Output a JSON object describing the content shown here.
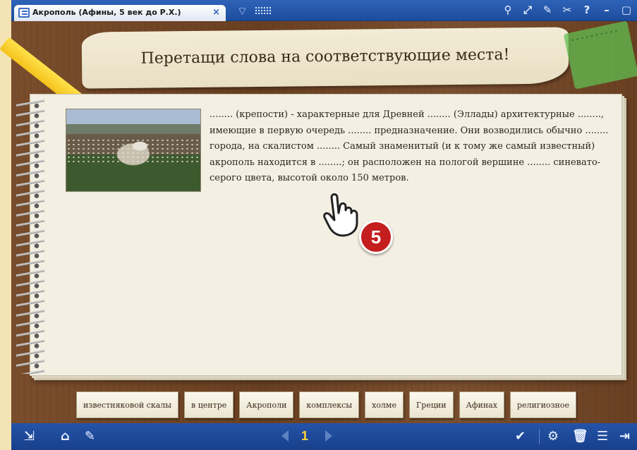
{
  "window": {
    "tab_title": "Акрополь (Афины, 5 век до Р.Х.)",
    "tab_close": "×",
    "toolbar_icons": [
      "share-icon",
      "fullscreen-icon",
      "pen-icon",
      "tools-icon",
      "help-icon",
      "minimize-icon",
      "maximize-icon"
    ],
    "toolbar_glyphs": [
      "⚲",
      "⤢",
      "✎",
      "✂",
      "?",
      "–",
      "▢"
    ]
  },
  "exercise": {
    "title": "Перетащи слова на соответствующие места!",
    "text": "........ (крепости) - характерные для Древней ........ (Эллады) архитектурные ........, имеющие в первую очередь ........ предназначение. Они возводились обычно ........ города, на скалистом ........ Самый знаменитый (и к тому же самый известный) акрополь находится в ........; он расположен на пологой вершине ........ синевато-серого цвета, высотой около 150 метров.",
    "step_number": "5"
  },
  "word_bank": [
    "известняковой скалы",
    "в центре",
    "Акрополи",
    "комплексы",
    "холме",
    "Греции",
    "Афинах",
    "религиозное"
  ],
  "bottom_bar": {
    "page_number": "1"
  },
  "colors": {
    "titlebar": "#2e63b8",
    "bottombar": "#2553a8",
    "badge": "#c51e1e",
    "page_number": "#ffd23a"
  }
}
